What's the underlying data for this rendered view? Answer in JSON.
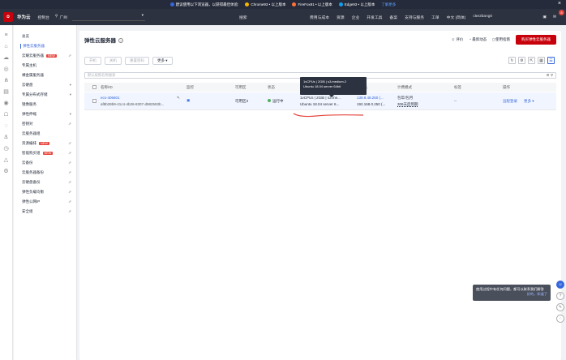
{
  "banner": {
    "text": "建议使用以下浏览器，以获得最佳体验:",
    "chrome": "Chrome93 • 以上版本",
    "firefox": "FireFox91 • 以上版本",
    "edge": "Edge93 • 以上版本",
    "more": "了解更多",
    "close": "×"
  },
  "topbar": {
    "brand": "华为云",
    "console": "控制台",
    "region": "广州",
    "search": "搜索",
    "links": [
      "费用与成本",
      "资源",
      "企业",
      "开发工具",
      "备案",
      "支持与服务",
      "工单",
      "中文 (简体)",
      "c5e2bang0"
    ],
    "notif_count": "8"
  },
  "sidebar": {
    "items": [
      {
        "label": "总览",
        "arrow": ""
      },
      {
        "label": "弹性云服务器",
        "arrow": ""
      },
      {
        "label": "云耀云服务器",
        "new": "NEW",
        "arrow": "⇗"
      },
      {
        "label": "专属主机",
        "arrow": ""
      },
      {
        "label": "裸金属服务器",
        "arrow": ""
      },
      {
        "label": "云硬盘",
        "arrow": "▾"
      },
      {
        "label": "专属分布式存储",
        "arrow": "▾"
      },
      {
        "label": "镜像服务",
        "arrow": ""
      },
      {
        "label": "弹性伸缩",
        "arrow": "▾"
      },
      {
        "label": "密钥对",
        "arrow": "⇗"
      },
      {
        "label": "云服务器组",
        "arrow": ""
      },
      {
        "label": "资源编排",
        "new": "NEW",
        "arrow": "⇗"
      },
      {
        "label": "智能购买组",
        "new": "NEW",
        "arrow": "⇗"
      },
      {
        "label": "云备份",
        "arrow": "⇗"
      },
      {
        "label": "云服务器备份",
        "arrow": "⇗"
      },
      {
        "label": "云硬盘备份",
        "arrow": "⇗"
      },
      {
        "label": "弹性负载均衡",
        "arrow": "⇗"
      },
      {
        "label": "弹性公网IP",
        "arrow": "⇗"
      },
      {
        "label": "安全组",
        "arrow": "⇗"
      }
    ]
  },
  "main": {
    "title": "弹性云服务器",
    "help": "?",
    "header_links": [
      "评价",
      "最新动态",
      "使用指南"
    ],
    "buy_button": "购买弹性云服务器",
    "toolbar": [
      "开机",
      "关机",
      "重置密码",
      "更多 ▾"
    ],
    "filter_placeholder": "默认按照名称搜索",
    "columns": [
      "名称/ID",
      "监控",
      "可用区",
      "状态",
      "规格/镜像",
      "IP地址",
      "计费模式",
      "标签",
      "操作"
    ],
    "row": {
      "name": "ecs-406601",
      "id": "af8b39b9-41c4-4b26-8307-d982593b...",
      "az": "可用区3",
      "status": "运行中",
      "spec1": "1vCPUs | 2GiB | s3.me...",
      "spec2": "Ubuntu 18.04 server 6...",
      "ip1": "139.9.48.250 (...",
      "ip2": "192.168.0.250 (...",
      "billing1": "包年/包月",
      "billing2": "306天后到期",
      "tag": "--",
      "op1": "远程登录",
      "op2": "更多 ▾"
    },
    "tooltip_line1": "1vCPUs | 2GiB | s3.medium.2",
    "tooltip_line2": "Ubuntu 18.04 server 64bit"
  },
  "notice": {
    "text": "使用过程中有任何问题，都可以联系我们解答",
    "tail": "好的，知道了"
  },
  "colors": {
    "accent": "#3666dd",
    "brand": "#c7000b",
    "topbar": "#2d3240"
  }
}
